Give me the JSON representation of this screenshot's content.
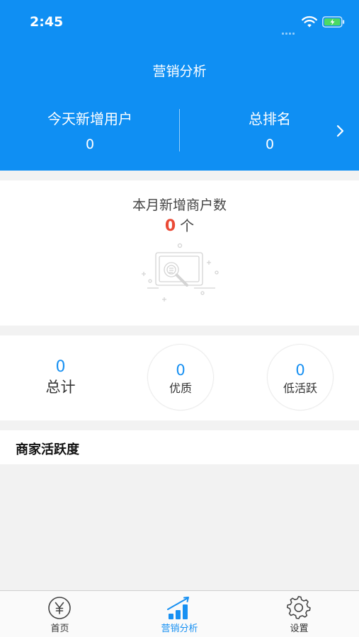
{
  "status_bar": {
    "time": "2:45"
  },
  "header": {
    "title": "营销分析",
    "stats": [
      {
        "label": "今天新增用户",
        "value": "0"
      },
      {
        "label": "总排名",
        "value": "0"
      }
    ]
  },
  "monthly": {
    "label": "本月新增商户数",
    "count": "0",
    "unit": "个"
  },
  "totals": {
    "total": {
      "value": "0",
      "label": "总计"
    },
    "quality": {
      "value": "0",
      "label": "优质"
    },
    "low_activity": {
      "value": "0",
      "label": "低活跃"
    }
  },
  "activity": {
    "title": "商家活跃度"
  },
  "tabbar": {
    "items": [
      {
        "label": "首页",
        "icon": "yen-circle-icon"
      },
      {
        "label": "营销分析",
        "icon": "bar-chart-icon"
      },
      {
        "label": "设置",
        "icon": "gear-icon"
      }
    ],
    "active_color": "#1790f2"
  },
  "colors": {
    "header_bg": "#0f8ff3",
    "accent": "#1790f2",
    "highlight": "#ea4a36"
  }
}
